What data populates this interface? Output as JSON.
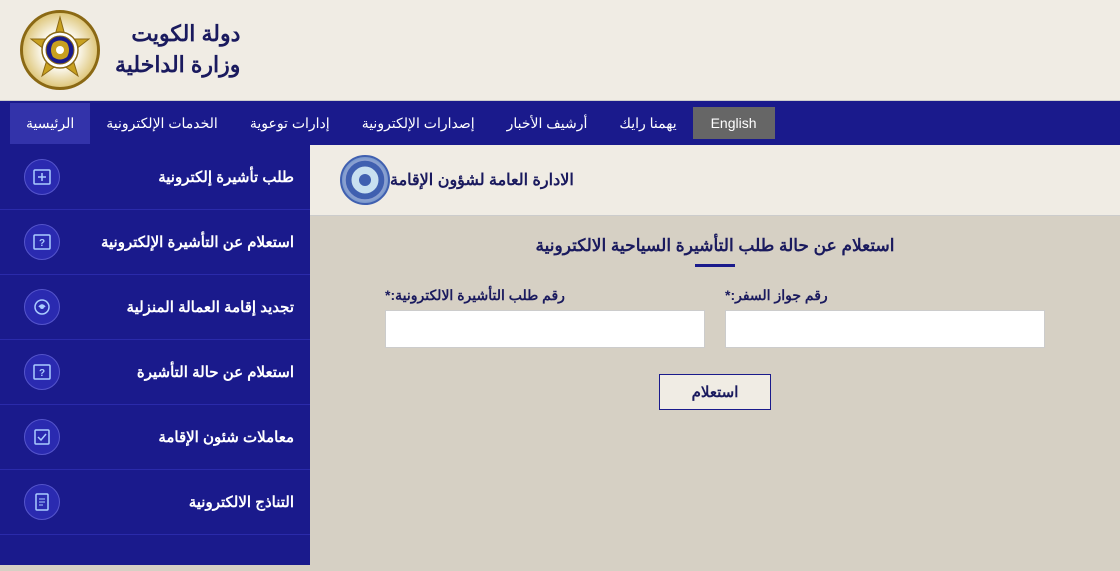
{
  "header": {
    "title_line1": "دولة الكويت",
    "title_line2": "وزارة الداخلية"
  },
  "navbar": {
    "items": [
      {
        "id": "home",
        "label": "الرئيسية",
        "active": true
      },
      {
        "id": "e-services",
        "label": "الخدمات الإلكترونية",
        "active": false
      },
      {
        "id": "awareness",
        "label": "إدارات توعوية",
        "active": false
      },
      {
        "id": "e-admin",
        "label": "إصدارات الإلكترونية",
        "active": false
      },
      {
        "id": "news",
        "label": "أرشيف الأخبار",
        "active": false
      },
      {
        "id": "opinion",
        "label": "يهمنا رايك",
        "active": false
      }
    ],
    "english_label": "English"
  },
  "sub_header": {
    "title": "الادارة العامة لشؤون الإقامة"
  },
  "form": {
    "title": "استعلام عن حالة طلب التأشيرة السياحية الالكترونية",
    "field_visa_label": "رقم طلب التأشيرة الالكترونية:*",
    "field_visa_placeholder": "",
    "field_passport_label": "رقم جواز السفر:*",
    "field_passport_placeholder": "",
    "submit_label": "استعلام"
  },
  "sidebar": {
    "items": [
      {
        "id": "apply-visa",
        "label": "طلب تأشيرة إلكترونية",
        "icon": "➕"
      },
      {
        "id": "inquire-evisa",
        "label": "استعلام عن التأشيرة الإلكترونية",
        "icon": "❓"
      },
      {
        "id": "renew-domestic",
        "label": "تجديد إقامة العمالة المنزلية",
        "icon": "⚙"
      },
      {
        "id": "inquire-visa",
        "label": "استعلام عن حالة التأشيرة",
        "icon": "❓"
      },
      {
        "id": "residence-affairs",
        "label": "معاملات شئون الإقامة",
        "icon": "📋"
      },
      {
        "id": "e-services-list",
        "label": "التناذج الالكترونية",
        "icon": "📄"
      }
    ]
  }
}
